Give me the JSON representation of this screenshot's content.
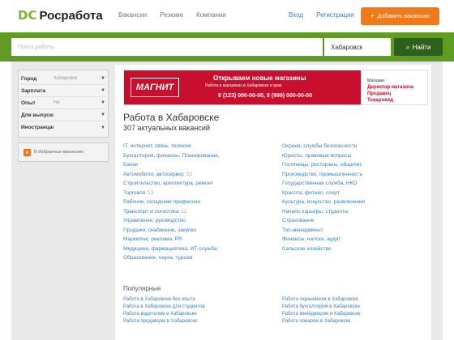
{
  "header": {
    "logo_text": "Росработа",
    "logo_mark": "DC",
    "nav": [
      "Вакансии",
      "Резюме",
      "Компании"
    ],
    "auth": [
      "Вход",
      "Регистрация"
    ],
    "post_button": "Добавить вакансию"
  },
  "search": {
    "placeholder": "Поиск работы",
    "city": "Хабаровск",
    "button": "Найти"
  },
  "filters": [
    {
      "label": "Город",
      "value": "Хабаровск"
    },
    {
      "label": "Зарплата",
      "value": ""
    },
    {
      "label": "Опыт",
      "value": "Не"
    },
    {
      "label": "Для выпускников",
      "value": ""
    },
    {
      "label": "Иностранцам",
      "value": ""
    }
  ],
  "favorites": {
    "text": "В Избранных вакансиях"
  },
  "banner": {
    "logo": "МАГНИТ",
    "title": "Открываем новые магазины",
    "subtitle": "Работа в магазинах в Хабаровске и крае",
    "phone": "8 (123) 000-00-00, 8 (999) 000-00-00",
    "right_lines": [
      "Магазин",
      "Директор магазина",
      "Продавец",
      "Товаровед"
    ]
  },
  "page": {
    "title": "Работа в Хабаровске",
    "count": "307 актуальных вакансий"
  },
  "categories_left": [
    {
      "label": "IT, интернет, связь, телеком",
      "num": ""
    },
    {
      "label": "Бухгалтерия, финансы, Планирование,",
      "num": ""
    },
    {
      "label": "Банки",
      "num": ""
    },
    {
      "label": "Автомобили, автосервис",
      "num": "21"
    },
    {
      "label": "Строительство, архитектура, ремонт",
      "num": ""
    },
    {
      "label": "Торговля",
      "num": "13"
    },
    {
      "label": "Рабочие, складские профессии",
      "num": ""
    },
    {
      "label": "Транспорт и логистика",
      "num": "11"
    },
    {
      "label": "Управление, руководство",
      "num": ""
    },
    {
      "label": "Продажи, снабжение, закупки",
      "num": ""
    },
    {
      "label": "Маркетинг, реклама, PR",
      "num": ""
    },
    {
      "label": "Медицина, фармацевтика, ИТ-служба",
      "num": ""
    },
    {
      "label": "Образование, наука, туризм",
      "num": ""
    }
  ],
  "categories_right": [
    {
      "label": "Охрана, службы безопасности",
      "num": ""
    },
    {
      "label": "Юристы, правовые вопросы",
      "num": ""
    },
    {
      "label": "Гостиницы, рестораны, общепит",
      "num": ""
    },
    {
      "label": "Производство, промышленность",
      "num": ""
    },
    {
      "label": "Государственная служба, НКО",
      "num": ""
    },
    {
      "label": "Красота, фитнес, спорт",
      "num": ""
    },
    {
      "label": "Культура, искусство, развлечения",
      "num": ""
    },
    {
      "label": "Начало карьеры, студенты",
      "num": ""
    },
    {
      "label": "Страхование",
      "num": ""
    },
    {
      "label": "Топ-менеджмент",
      "num": ""
    },
    {
      "label": "Финансы, налоги, аудит",
      "num": ""
    },
    {
      "label": "Сельское хозяйство",
      "num": ""
    }
  ],
  "popular": {
    "title": "Популярные",
    "left": [
      "Работа в Хабаровске без опыта",
      "Работа в Хабаровске для студентов",
      "Работа водителем в Хабаровске",
      "Работа продавцом в Хабаровске"
    ],
    "right": [
      "Работа охранником в Хабаровске",
      "Работа бухгалтером в Хабаровске",
      "Работа менеджером в Хабаровске",
      "Работа поваром в Хабаровске"
    ]
  },
  "colors": {
    "brand_green": "#5e9c23",
    "dark_green": "#2f5f1c",
    "accent_orange": "#f07a1a",
    "banner_red": "#c8102e",
    "link_blue": "#3a7fc1"
  }
}
